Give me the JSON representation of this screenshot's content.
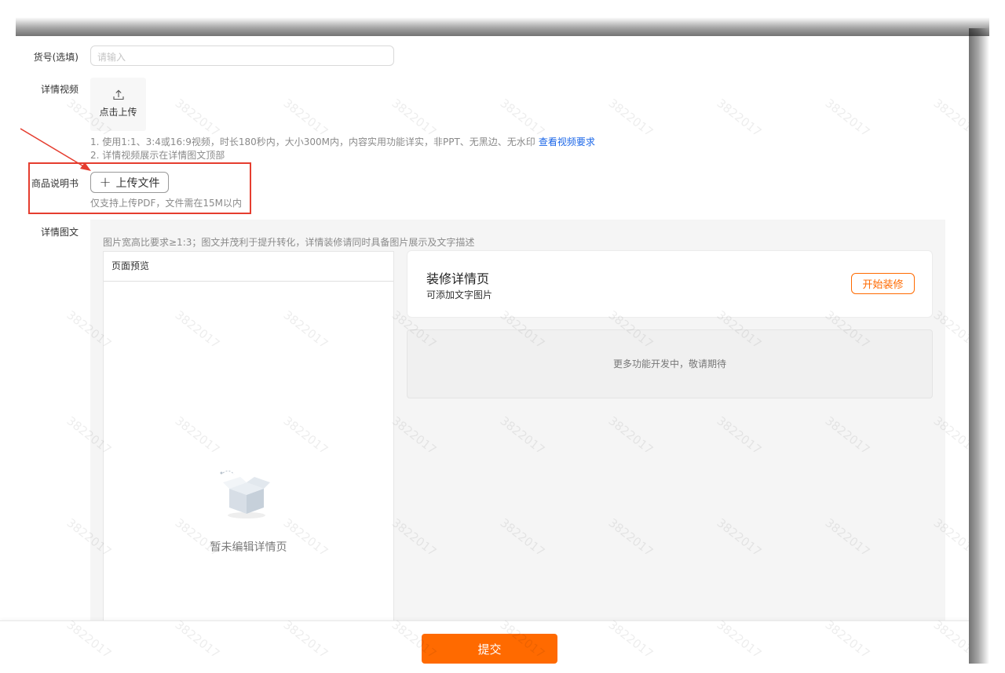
{
  "form": {
    "sku": {
      "label": "货号(选填)",
      "placeholder": "请输入"
    },
    "video": {
      "label": "详情视频",
      "upload_label": "点击上传",
      "hint1": "1. 使用1:1、3:4或16:9视频，时长180秒内，大小300M内，内容实用功能详实，非PPT、无黑边、无水印",
      "hint1_link": "查看视频要求",
      "hint2": "2. 详情视频展示在详情图文顶部"
    },
    "manual": {
      "label": "商品说明书",
      "button_label": "上传文件",
      "hint": "仅支持上传PDF，文件需在15M以内"
    },
    "detail": {
      "label": "详情图文",
      "hint": "图片宽高比要求≥1:3；图文并茂利于提升转化，详情装修请同时具备图片展示及文字描述",
      "preview": {
        "title": "页面预览",
        "empty_text": "暂未编辑详情页"
      },
      "decoration": {
        "title": "装修详情页",
        "subtitle": "可添加文字图片",
        "button_label": "开始装修"
      },
      "more_text": "更多功能开发中，敬请期待"
    }
  },
  "footer": {
    "submit_label": "提交"
  },
  "watermark": "3822017",
  "colors": {
    "accent": "#ff6a00",
    "link": "#1a66e8",
    "annotation": "#e53d2f"
  },
  "icons": [
    "upload-icon",
    "plus-icon",
    "empty-box-icon",
    "annotation-arrow"
  ]
}
